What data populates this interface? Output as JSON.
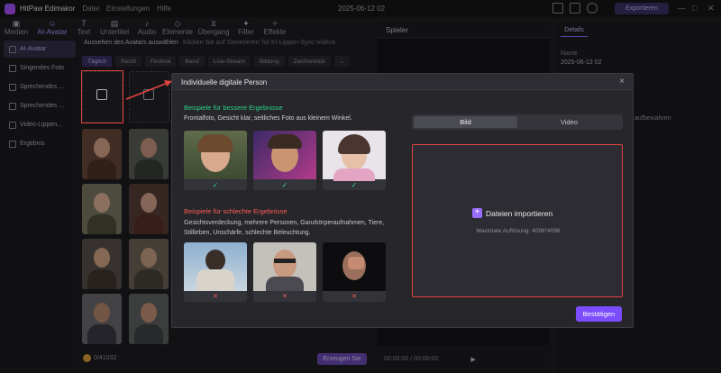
{
  "app": {
    "name": "HitPaw Edimakor",
    "menu": [
      "Datei",
      "Einstellungen",
      "Hilfe"
    ],
    "date": "2025-06-12 02",
    "export_label": "Exportieren"
  },
  "toolbar": [
    {
      "icon": "media-icon",
      "label": "Medien"
    },
    {
      "icon": "ai-avatar-icon",
      "label": "AI-Avatar"
    },
    {
      "icon": "text-icon",
      "label": "Text"
    },
    {
      "icon": "subtitle-icon",
      "label": "Untertitel"
    },
    {
      "icon": "audio-icon",
      "label": "Audio"
    },
    {
      "icon": "elements-icon",
      "label": "Elemente"
    },
    {
      "icon": "transition-icon",
      "label": "Übergang"
    },
    {
      "icon": "filter-icon",
      "label": "Filter"
    },
    {
      "icon": "effects-icon",
      "label": "Effekte"
    }
  ],
  "leftnav": [
    {
      "label": "AI-Avatar",
      "active": true
    },
    {
      "label": "Singendes Foto",
      "active": false
    },
    {
      "label": "Sprechendes ...",
      "active": false
    },
    {
      "label": "Sprechendes ...",
      "active": false
    },
    {
      "label": "Video-Lippen...",
      "active": false
    },
    {
      "label": "Ergebnis",
      "active": false
    }
  ],
  "avatar_section": {
    "heading": "Aussehen des Avatars auswählen",
    "hint": "Klicken Sie auf 'Generieren' für KI-Lippen-Sync-Videos.",
    "filters": [
      "Täglich",
      "Recht",
      "Festival",
      "Beruf",
      "Live-Stream",
      "Bildung",
      "Zeichentrick"
    ],
    "credits": "0/41032",
    "generate_label": "Erzeugen Sie"
  },
  "player": {
    "title": "Spieler",
    "time": "00:00:00 / 00:00:00"
  },
  "details": {
    "tab": "Details",
    "name_label": "Name",
    "name_value": "2025-06-12 02",
    "side_text": "aufbewahren"
  },
  "modal": {
    "title": "Individuelle digitale Person",
    "good_title": "Beispiele für bessere Ergebnisse",
    "good_sub": "Frontalfoto, Gesicht klar, seitliches Foto aus kleinem Winkel.",
    "bad_title": "Beispiele für schlechte Ergebnisse",
    "bad_sub": "Gesichtsverdeckung, mehrere Personen, Ganzkörperaufnahmen, Tiere, Stillleben, Unschärfe, schlechte Beleuchtung.",
    "tabs": [
      "Bild",
      "Video"
    ],
    "import_label": "Dateien importieren",
    "resolution": "Maximale Auflösung: 4096*4096",
    "confirm_label": "Bestätigen",
    "ok_mark": "✓",
    "bad_mark": "✕"
  },
  "colors": {
    "accent": "#7c4dff",
    "good": "#2fd38a",
    "bad": "#ff5d56",
    "highlight": "#e2443f"
  }
}
